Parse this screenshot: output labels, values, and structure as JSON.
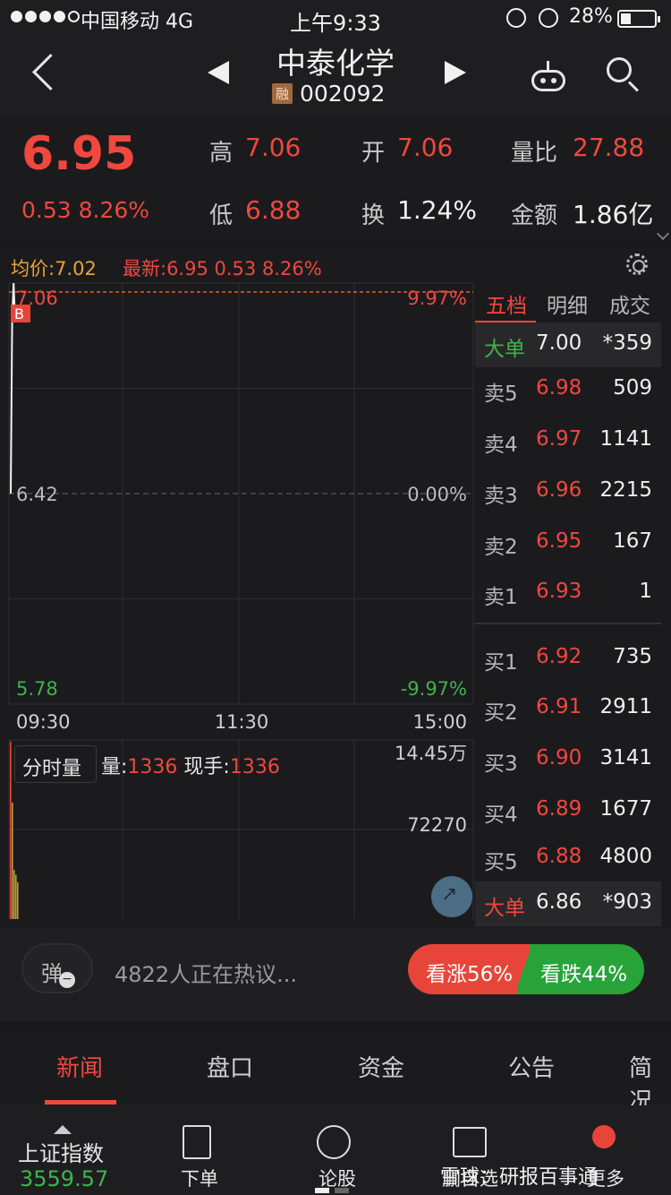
{
  "status_bar": {
    "carrier": "中国移动  4G",
    "time": "上午9:33",
    "battery": "28%"
  },
  "header": {
    "stock_name": "中泰化学",
    "badge": "融",
    "stock_code": "002092"
  },
  "quote": {
    "price": "6.95",
    "change": "0.53  8.26%",
    "labels": {
      "high": "高",
      "open": "开",
      "volume_ratio": "量比",
      "low": "低",
      "turnover": "换",
      "amount": "金额"
    },
    "values": {
      "high": "7.06",
      "open": "7.06",
      "volume_ratio": "27.88",
      "low": "6.88",
      "turnover": "1.24%",
      "amount": "1.86亿"
    }
  },
  "chart_info": {
    "avg_price": "均价:7.02",
    "latest": "最新:6.95  0.53  8.26%",
    "buy_marker": "B"
  },
  "chart_data": {
    "type": "line",
    "title": "",
    "y_labels_left": [
      "7.06",
      "6.42",
      "5.78"
    ],
    "y_labels_right": [
      "9.97%",
      "0.00%",
      "-9.97%"
    ],
    "ylim": [
      5.78,
      7.06
    ],
    "x_labels": [
      "09:30",
      "11:30",
      "15:00"
    ],
    "series": [
      {
        "values": [
          6.42,
          6.95,
          7.06,
          6.95
        ]
      }
    ],
    "volume": {
      "label": "分时量",
      "y_labels": [
        "14.45万",
        "72270"
      ],
      "ylim": [
        0,
        144500
      ],
      "bars": [
        144500,
        95000,
        40000,
        36000,
        30000
      ]
    }
  },
  "volume_info": {
    "qty_label": "量:",
    "qty": "1336",
    "now_label": " 现手:",
    "now": "1336"
  },
  "order_book": {
    "tabs": [
      "五档",
      "明细",
      "成交"
    ],
    "big_sell": {
      "label": "大单",
      "price": "7.00",
      "vol": "*359"
    },
    "asks": [
      {
        "label": "卖5",
        "price": "6.98",
        "vol": "509"
      },
      {
        "label": "卖4",
        "price": "6.97",
        "vol": "1141"
      },
      {
        "label": "卖3",
        "price": "6.96",
        "vol": "2215"
      },
      {
        "label": "卖2",
        "price": "6.95",
        "vol": "167"
      },
      {
        "label": "卖1",
        "price": "6.93",
        "vol": "1"
      }
    ],
    "bids": [
      {
        "label": "买1",
        "price": "6.92",
        "vol": "735"
      },
      {
        "label": "买2",
        "price": "6.91",
        "vol": "2911"
      },
      {
        "label": "买3",
        "price": "6.90",
        "vol": "3141"
      },
      {
        "label": "买4",
        "price": "6.89",
        "vol": "1677"
      },
      {
        "label": "买5",
        "price": "6.88",
        "vol": "4800"
      }
    ],
    "big_buy": {
      "label": "大单",
      "price": "6.86",
      "vol": "*903"
    }
  },
  "discussion": {
    "danmu": "弹",
    "hot_text": "4822人正在热议...",
    "bull": "看涨56%",
    "bear": "看跌44%"
  },
  "news_tabs": [
    "新闻",
    "盘口",
    "资金",
    "公告",
    "简况"
  ],
  "bottom_bar": {
    "index_name": "上证指数",
    "index_value": "3559.57",
    "items": [
      "下单",
      "论股",
      "删自选",
      "更多"
    ],
    "watermark": "雪球：研报百事通"
  },
  "colors": {
    "up": "#f0473e",
    "down": "#3fb34f",
    "avg": "#e9a23b",
    "bg": "#1b1b1d"
  }
}
